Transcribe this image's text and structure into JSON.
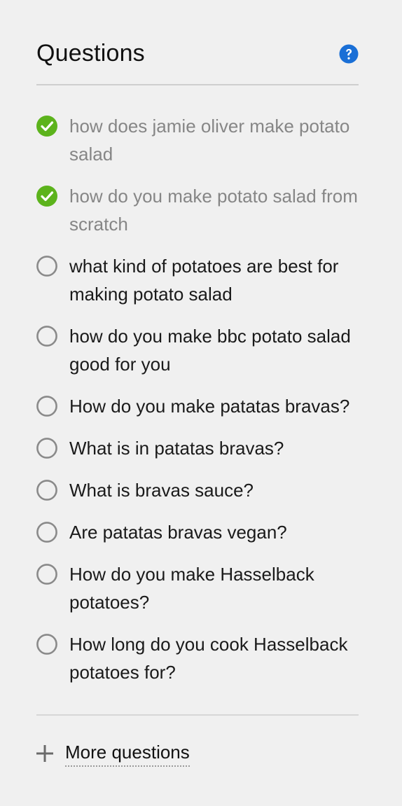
{
  "header": {
    "title": "Questions",
    "help_icon": "question-circle-icon",
    "help_color": "#1a6fd6"
  },
  "colors": {
    "checked": "#5cb31c",
    "unchecked_ring": "#8a8a8a",
    "done_text": "#868686"
  },
  "questions": [
    {
      "text": "how does jamie oliver make potato salad",
      "checked": true
    },
    {
      "text": "how do you make potato salad from scratch",
      "checked": true
    },
    {
      "text": "what kind of potatoes are best for making potato salad",
      "checked": false
    },
    {
      "text": "how do you make bbc potato salad good for you",
      "checked": false
    },
    {
      "text": "How do you make patatas bravas?",
      "checked": false
    },
    {
      "text": "What is in patatas bravas?",
      "checked": false
    },
    {
      "text": "What is bravas sauce?",
      "checked": false
    },
    {
      "text": "Are patatas bravas vegan?",
      "checked": false
    },
    {
      "text": "How do you make Hasselback potatoes?",
      "checked": false
    },
    {
      "text": "How long do you cook Hasselback potatoes for?",
      "checked": false
    }
  ],
  "footer": {
    "more_label": "More questions",
    "more_icon": "plus-icon"
  }
}
